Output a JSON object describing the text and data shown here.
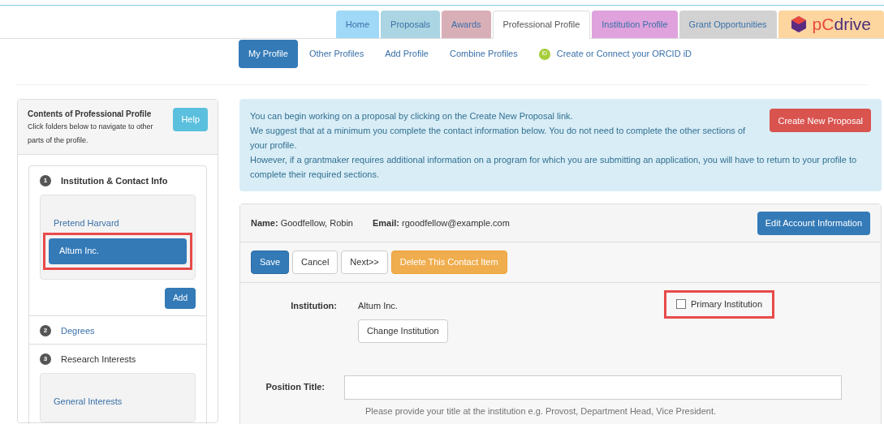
{
  "tabs": [
    {
      "label": "Home",
      "selected": false,
      "color": "#9fd9f7"
    },
    {
      "label": "Proposals",
      "selected": false,
      "color": "#abd5e2"
    },
    {
      "label": "Awards",
      "selected": false,
      "color": "#d9afb7"
    },
    {
      "label": "Professional Profile",
      "selected": true,
      "color": "#ffffff"
    },
    {
      "label": "Institution Profile",
      "selected": false,
      "color": "#dfa2dc"
    },
    {
      "label": "Grant Opportunities",
      "selected": false,
      "color": "#d2d2d2"
    }
  ],
  "brand": {
    "prefix": "pC",
    "suffix": "drive"
  },
  "subnav": [
    {
      "label": "My Profile",
      "selected": true,
      "kind": "link"
    },
    {
      "label": "Other Profiles",
      "selected": false,
      "kind": "link"
    },
    {
      "label": "Add Profile",
      "selected": false,
      "kind": "link"
    },
    {
      "label": "Combine Profiles",
      "selected": false,
      "kind": "link"
    },
    {
      "label": "Create or Connect your ORCID iD",
      "selected": false,
      "kind": "orcid",
      "badge": "iD"
    }
  ],
  "sidebar": {
    "title": "Contents of Professional Profile",
    "subtitle": "Click folders below to navigate to other parts of the profile.",
    "help": "Help",
    "sections": [
      {
        "number": "1",
        "title": "Institution & Contact Info",
        "expanded": true,
        "add": "Add",
        "items": [
          {
            "label": "Pretend Harvard",
            "selected": false,
            "highlighted": false
          },
          {
            "label": "Altum Inc.",
            "selected": true,
            "highlighted": true
          }
        ]
      },
      {
        "number": "2",
        "title": "Degrees",
        "expanded": false
      },
      {
        "number": "3",
        "title": "Research Interests",
        "expanded": true,
        "items": [
          {
            "label": "General Interests",
            "selected": false,
            "highlighted": false
          }
        ]
      }
    ]
  },
  "notice": {
    "lines": [
      "You can begin working on a proposal by clicking on the Create New Proposal link.",
      "We suggest that at a minimum you complete the contact information below. You do not need to complete the other sections of your profile.",
      "However, if a grantmaker requires additional information on a program for which you are submitting an application, you will have to return to your profile to complete their required sections."
    ],
    "button": "Create New Proposal"
  },
  "account": {
    "name_label": "Name:",
    "name": "Goodfellow, Robin",
    "email_label": "Email:",
    "email": "rgoodfellow@example.com",
    "button": "Edit Account Information"
  },
  "actions": [
    {
      "label": "Save",
      "kind": "primary"
    },
    {
      "label": "Cancel",
      "kind": "default"
    },
    {
      "label": "Next>>",
      "kind": "default"
    },
    {
      "label": "Delete This Contact Item",
      "kind": "warning"
    }
  ],
  "form": {
    "institution_label": "Institution:",
    "institution": "Altum Inc.",
    "change_button": "Change Institution",
    "primary": {
      "label": "Primary Institution",
      "checked": false,
      "highlighted": true
    },
    "position_label": "Position Title:",
    "position_help": "Please provide your title at the institution e.g. Provost, Department Head, Vice President."
  }
}
